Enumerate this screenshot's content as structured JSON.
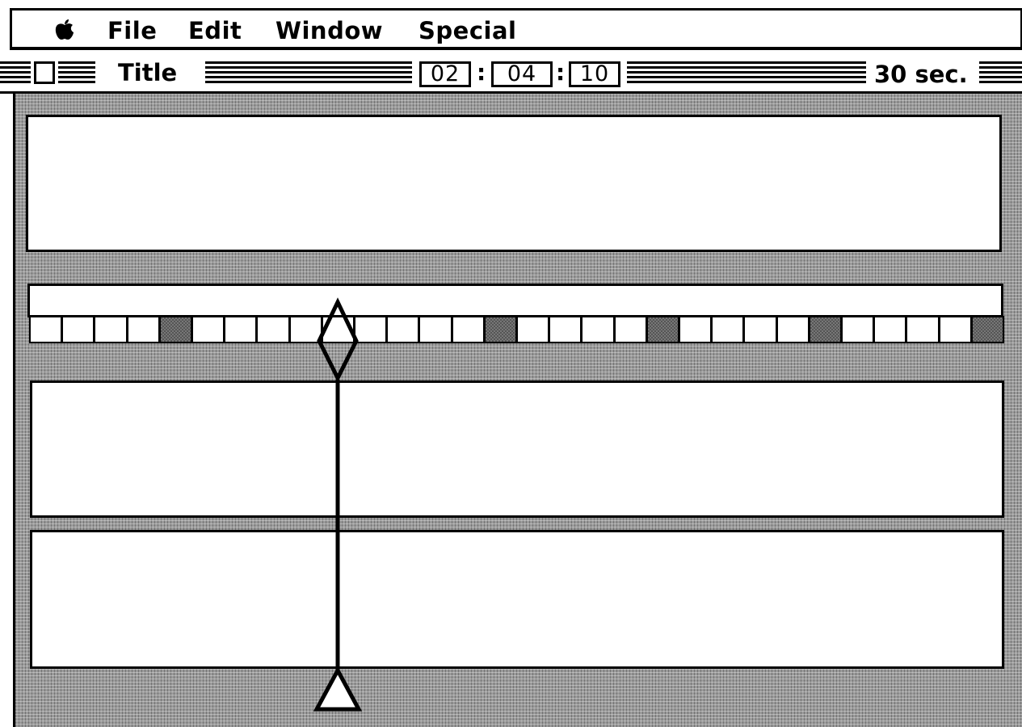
{
  "menubar": {
    "apple_icon": "apple-icon",
    "items": [
      "File",
      "Edit",
      "Window",
      "Special"
    ]
  },
  "window": {
    "title": "Title",
    "timecode": {
      "hours": "02",
      "minutes": "04",
      "seconds": "10",
      "separator": ":"
    },
    "duration": "30 sec."
  },
  "timeline": {
    "frame_count": 30,
    "key_frames": [
      4,
      14,
      19,
      24,
      29
    ],
    "playhead_frame": 9,
    "playhead_icon": "diamond-playhead-icon",
    "end_marker_icon": "triangle-marker-icon"
  },
  "colors": {
    "background": "#9a9a9a",
    "panel": "#ffffff",
    "ink": "#000000",
    "key_frame": "#555555"
  }
}
